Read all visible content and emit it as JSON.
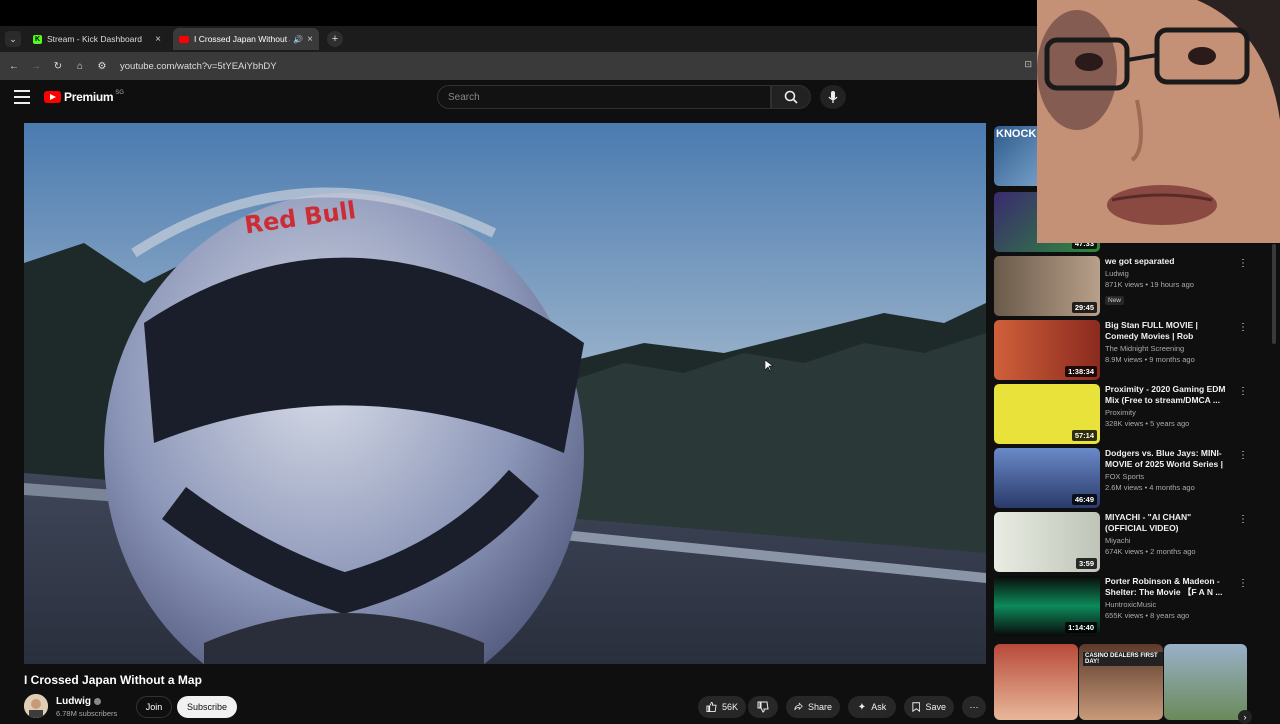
{
  "browser": {
    "tabs": [
      {
        "label": "Stream - Kick Dashboard",
        "favicon": "K"
      },
      {
        "label": "I Crossed Japan Without a M",
        "favicon": "youtube-icon"
      }
    ],
    "new_tab_label": "+",
    "url": "youtube.com/watch?v=5tYEAiYbhDY"
  },
  "youtube": {
    "logo_text": "Premium",
    "logo_country": "SG",
    "search_placeholder": "Search"
  },
  "video": {
    "title": "I Crossed Japan Without a Map",
    "channel": "Ludwig",
    "subscribers": "6.78M subscribers",
    "join_label": "Join",
    "subscribe_label": "Subscribe",
    "likes": "56K",
    "share_label": "Share",
    "ask_label": "Ask",
    "save_label": "Save",
    "more_label": "⋯"
  },
  "recommendations": [
    {
      "title": "",
      "channel": "",
      "meta": "",
      "duration": "",
      "thumb": "#2e5b8c"
    },
    {
      "title": "",
      "channel": "",
      "meta": "",
      "duration": "47:33",
      "thumb": "#3a2a70"
    },
    {
      "title": "we got separated",
      "channel": "Ludwig",
      "meta": "871K views • 19 hours ago",
      "duration": "29:45",
      "badge": "New",
      "thumb": "#7a6a5a"
    },
    {
      "title": "Big Stan FULL MOVIE | Comedy Movies | Rob Schneider | The ...",
      "channel": "The Midnight Screening",
      "meta": "8.9M views • 9 months ago",
      "duration": "1:38:34",
      "thumb": "#b8462e"
    },
    {
      "title": "Proximity - 2020 Gaming EDM Mix (Free to stream/DMCA ...",
      "channel": "Proximity",
      "meta": "328K views • 5 years ago",
      "duration": "57:14",
      "thumb": "#e8e23a"
    },
    {
      "title": "Dodgers vs. Blue Jays: MINI-MOVIE of 2025 World Series | ...",
      "channel": "FOX Sports",
      "meta": "2.6M views • 4 months ago",
      "duration": "46:49",
      "thumb": "#3a4a7a"
    },
    {
      "title": "MIYACHI - \"AI CHAN\" (OFFICIAL VIDEO)",
      "channel": "Miyachi",
      "meta": "674K views • 2 months ago",
      "duration": "3:59",
      "thumb": "#d8dcd2"
    },
    {
      "title": "Porter Robinson & Madeon - Shelter: The Movie 【F A N ...",
      "channel": "HuntroxicMusic",
      "meta": "655K views • 8 years ago",
      "duration": "1:14:40",
      "thumb": "#0c8a5a"
    }
  ],
  "shorts": [
    {
      "label": "",
      "thumb": "#b84a3a"
    },
    {
      "label": "CASINO DEALERS FIRST DAY!",
      "thumb": "#5a3a2a"
    },
    {
      "label": "",
      "thumb": "#9ab0c8"
    }
  ],
  "webcam_overlay": {
    "title": ""
  },
  "colors": {
    "bg": "#0f0f0f",
    "accent": "#ff0000",
    "kick": "#53fc18"
  }
}
